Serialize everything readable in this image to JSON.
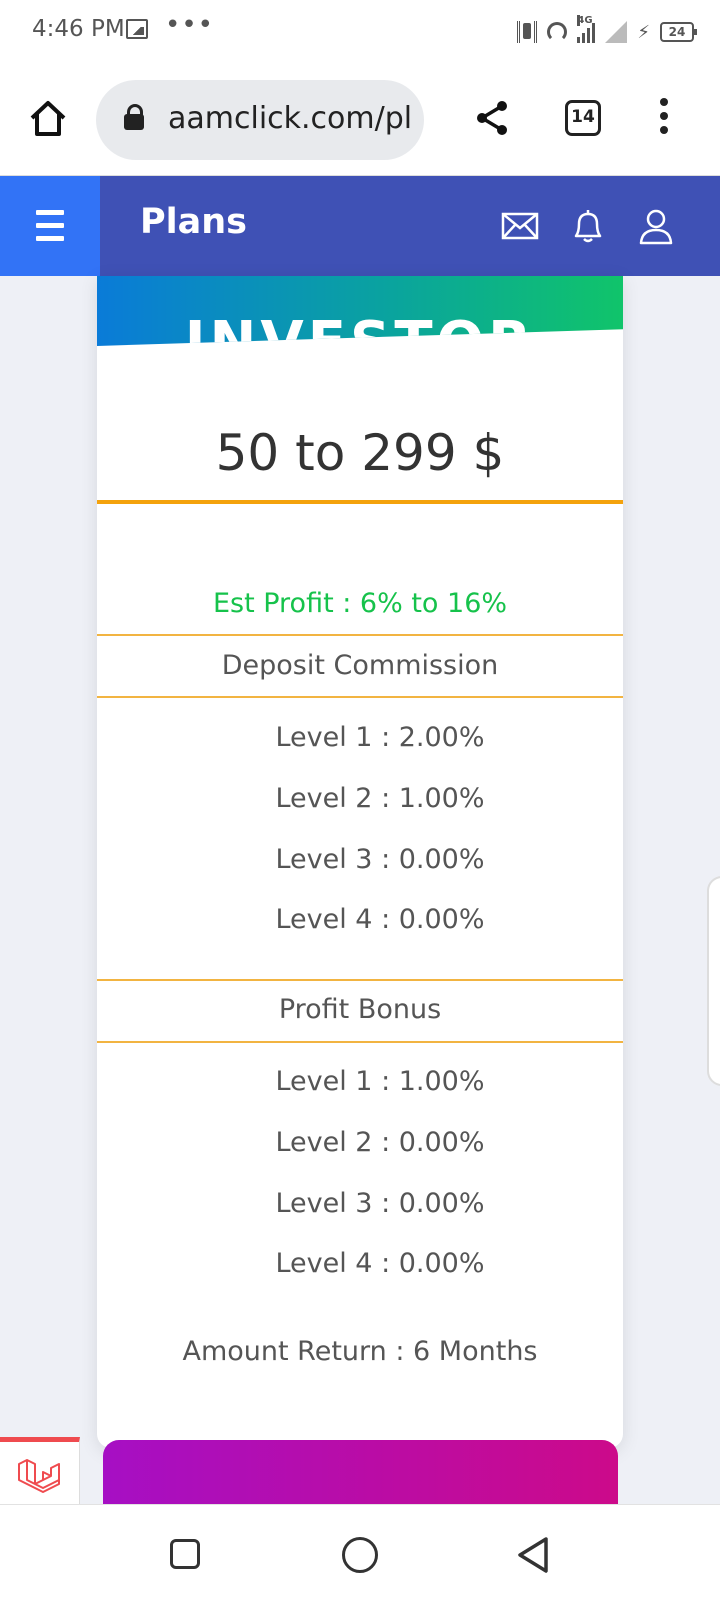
{
  "status_bar": {
    "time": "4:46 PM",
    "network_tag": "4G",
    "battery": "24"
  },
  "browser": {
    "url": "aamclick.com/pl",
    "tab_count": "14"
  },
  "header": {
    "title": "Plans",
    "color": "#3f51b5",
    "menu_color": "#3273f6"
  },
  "plan": {
    "banner_title": "INVESTOR",
    "price_range": "50 to 299 $",
    "est_profit": "Est Profit : 6% to 16%",
    "deposit_commission": {
      "title": "Deposit Commission",
      "levels": [
        "Level 1 : 2.00%",
        "Level 2 : 1.00%",
        "Level 3 : 0.00%",
        "Level 4 : 0.00%"
      ]
    },
    "profit_bonus": {
      "title": "Profit Bonus",
      "levels": [
        "Level 1 : 1.00%",
        "Level 2 : 0.00%",
        "Level 3 : 0.00%",
        "Level 4 : 0.00%"
      ]
    },
    "amount_return": "Amount Return : 6 Months",
    "accent_color": "#f4a20c",
    "profit_color": "#16c24b"
  },
  "icons": [
    "home-icon",
    "lock-icon",
    "share-icon",
    "tabs-icon",
    "more-vert-icon",
    "hamburger-icon",
    "mail-icon",
    "bell-icon",
    "user-icon",
    "laravel-icon",
    "recents-icon",
    "nav-home-icon",
    "back-icon"
  ]
}
